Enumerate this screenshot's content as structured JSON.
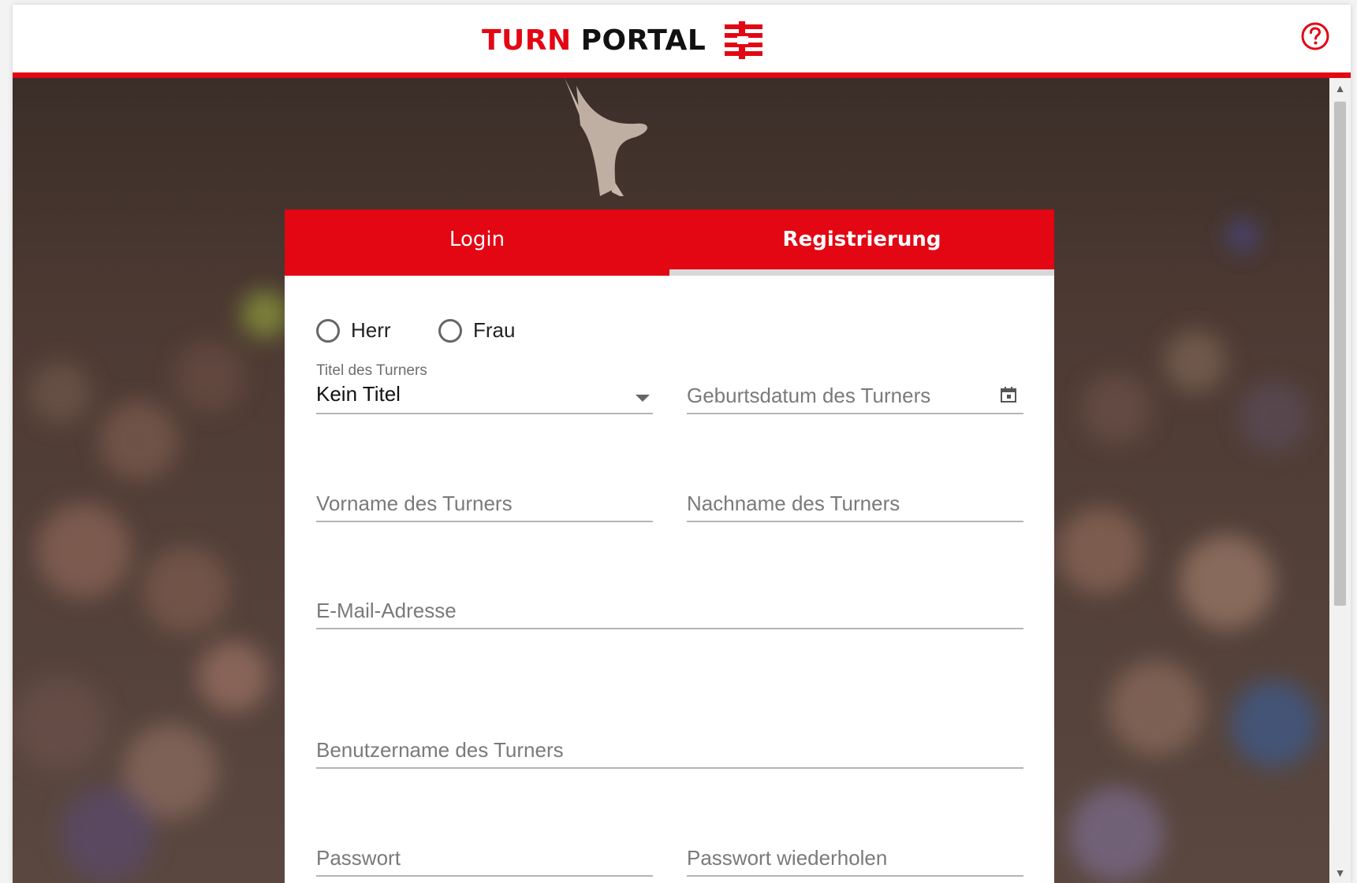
{
  "header": {
    "brand_part1": "TURN",
    "brand_part2": "PORTAL",
    "logo_icon": "dtb-logo-icon",
    "help_icon": "help-circle-icon",
    "accent_color": "#e30613"
  },
  "tabs": [
    {
      "label": "Login",
      "active": false
    },
    {
      "label": "Registrierung",
      "active": true
    }
  ],
  "form": {
    "salutation": {
      "options": [
        "Herr",
        "Frau"
      ],
      "selected": null
    },
    "titel": {
      "label": "Titel des Turners",
      "value": "Kein Titel"
    },
    "geburtsdatum": {
      "placeholder": "Geburtsdatum des Turners"
    },
    "vorname": {
      "placeholder": "Vorname des Turners"
    },
    "nachname": {
      "placeholder": "Nachname des Turners"
    },
    "email": {
      "placeholder": "E-Mail-Adresse"
    },
    "username": {
      "placeholder": "Benutzername des Turners"
    },
    "passwort": {
      "placeholder": "Passwort"
    },
    "passwort_wiederholen": {
      "placeholder": "Passwort wiederholen"
    }
  }
}
